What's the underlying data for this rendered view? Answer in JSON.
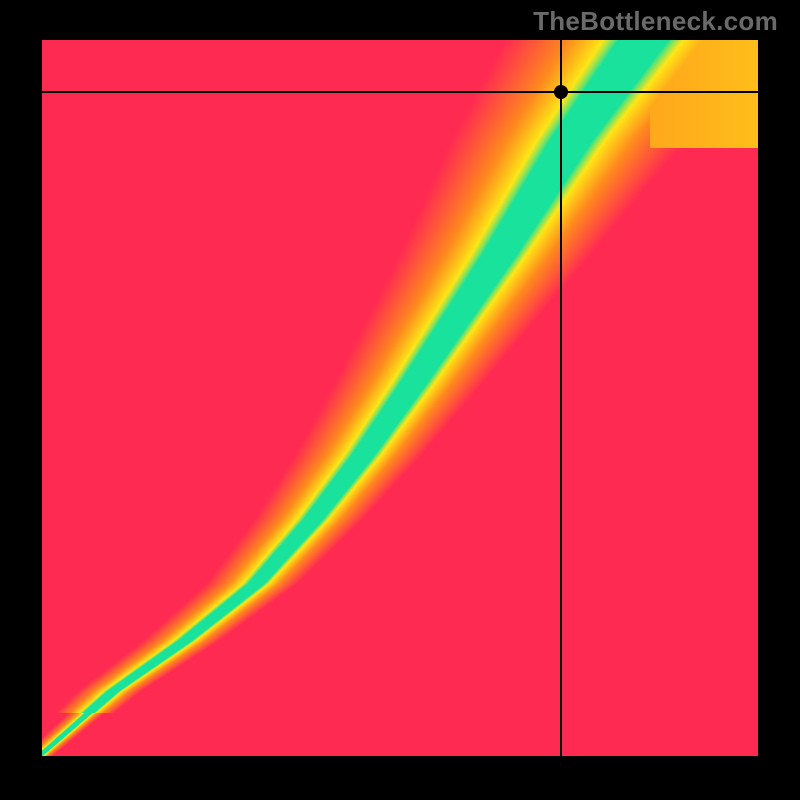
{
  "watermark": "TheBottleneck.com",
  "crosshair": {
    "x_frac": 0.725,
    "y_frac": 0.072
  },
  "colors": {
    "red": "#ff2a52",
    "orange": "#ff8a1e",
    "yellow": "#ffe617",
    "green": "#18e29b"
  },
  "chart_data": {
    "type": "heatmap",
    "title": "",
    "xlabel": "",
    "ylabel": "",
    "xlim": [
      0,
      1
    ],
    "ylim": [
      0,
      1
    ],
    "description": "Diagonal green optimal band from bottom-left to upper region with a slight S-curve; red at lower-left and lower-right extremes; smooth gradient through orange and yellow between.",
    "marker_point": {
      "x": 0.725,
      "y": 0.928
    },
    "optimal_band": {
      "comment": "Approximate centerline of the green band in normalized coords (x, y from bottom-left); band half-width ~0.04.",
      "half_width": 0.04,
      "points": [
        {
          "x": 0.02,
          "y": 0.02
        },
        {
          "x": 0.1,
          "y": 0.09
        },
        {
          "x": 0.2,
          "y": 0.16
        },
        {
          "x": 0.3,
          "y": 0.24
        },
        {
          "x": 0.38,
          "y": 0.33
        },
        {
          "x": 0.45,
          "y": 0.42
        },
        {
          "x": 0.52,
          "y": 0.52
        },
        {
          "x": 0.58,
          "y": 0.61
        },
        {
          "x": 0.64,
          "y": 0.7
        },
        {
          "x": 0.69,
          "y": 0.78
        },
        {
          "x": 0.74,
          "y": 0.86
        },
        {
          "x": 0.79,
          "y": 0.93
        },
        {
          "x": 0.84,
          "y": 1.0
        }
      ]
    },
    "corner_colors": {
      "bottom_left": "red",
      "bottom_right": "red",
      "top_left": "red-orange",
      "top_right": "yellow"
    }
  }
}
